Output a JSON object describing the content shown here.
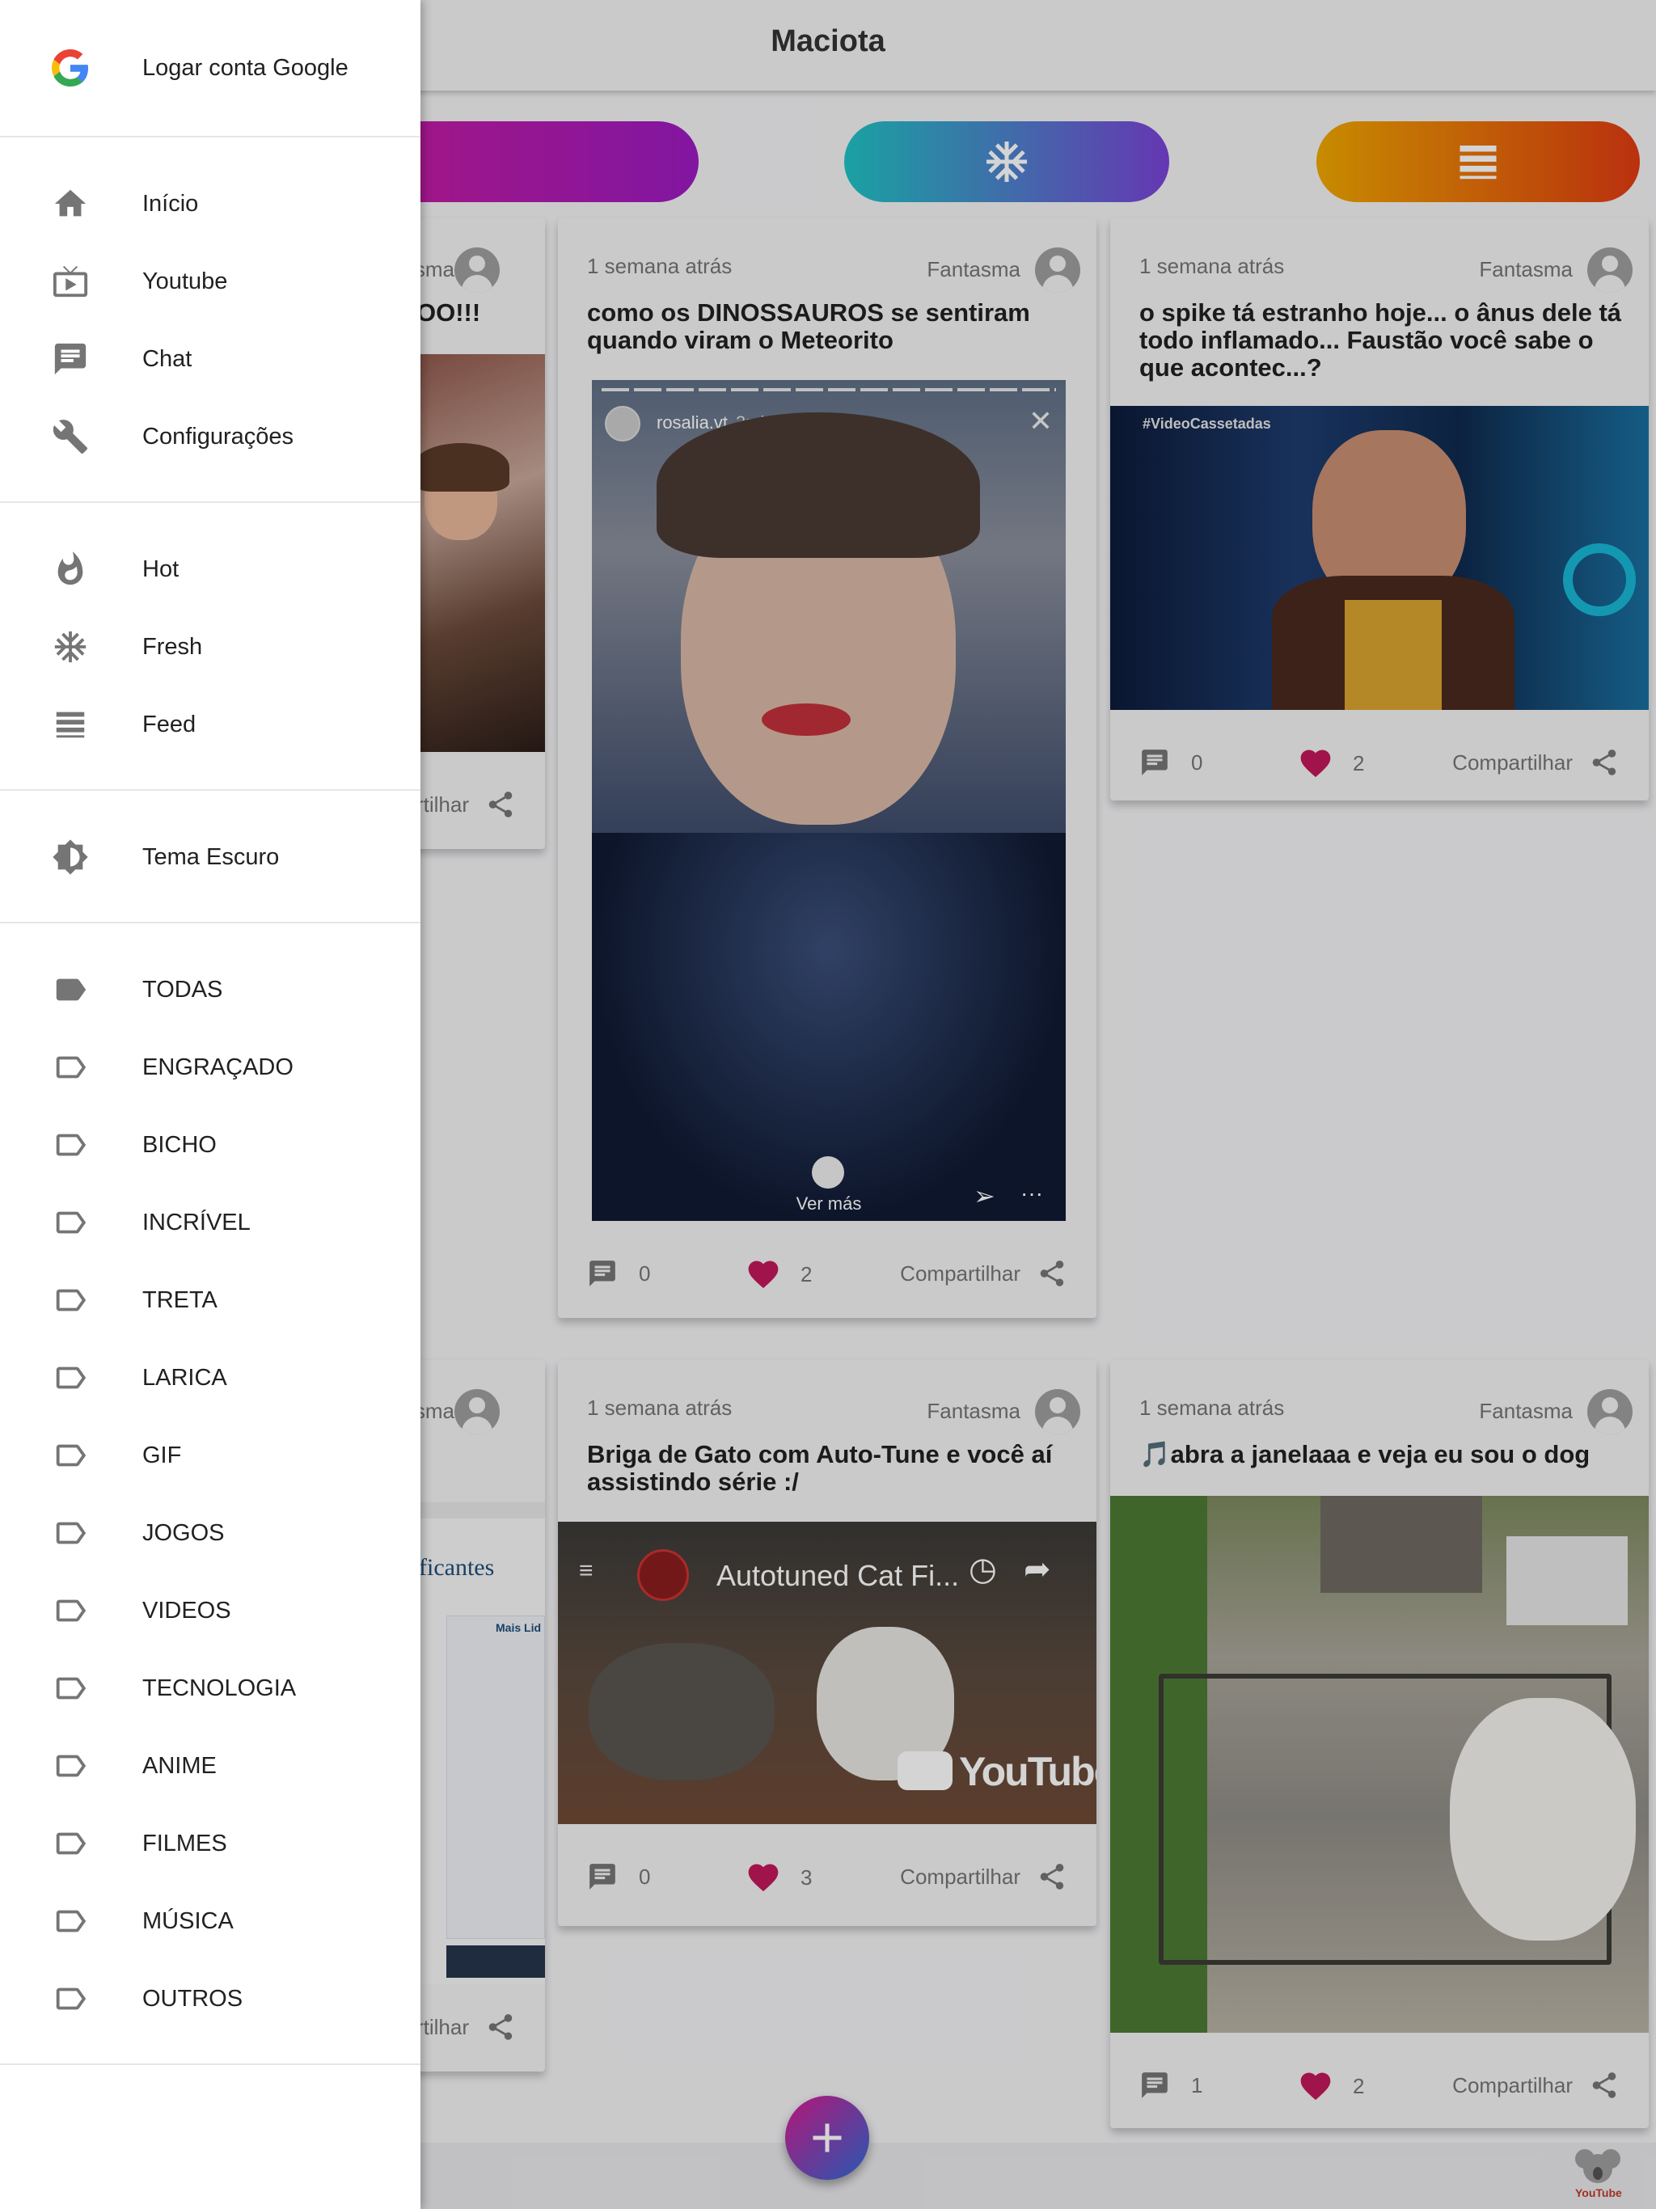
{
  "app": {
    "title": "Maciota"
  },
  "pills": [
    "hot-icon",
    "snowflake-icon",
    "feed-icon"
  ],
  "drawer": {
    "account": {
      "label": "Logar conta Google",
      "icon": "google-icon"
    },
    "nav": [
      {
        "label": "Início",
        "icon": "home-icon"
      },
      {
        "label": "Youtube",
        "icon": "tv-icon"
      },
      {
        "label": "Chat",
        "icon": "chat-icon"
      },
      {
        "label": "Configurações",
        "icon": "wrench-icon"
      }
    ],
    "feeds": [
      {
        "label": "Hot",
        "icon": "flame-icon"
      },
      {
        "label": "Fresh",
        "icon": "snowflake-icon"
      },
      {
        "label": "Feed",
        "icon": "feed-icon"
      }
    ],
    "theme": {
      "label": "Tema Escuro",
      "icon": "brightness-icon"
    },
    "categories": [
      {
        "label": "TODAS",
        "icon": "label-filled-icon"
      },
      {
        "label": "ENGRAÇADO",
        "icon": "label-outline-icon"
      },
      {
        "label": "BICHO",
        "icon": "label-outline-icon"
      },
      {
        "label": "INCRÍVEL",
        "icon": "label-outline-icon"
      },
      {
        "label": "TRETA",
        "icon": "label-outline-icon"
      },
      {
        "label": "LARICA",
        "icon": "label-outline-icon"
      },
      {
        "label": "GIF",
        "icon": "label-outline-icon"
      },
      {
        "label": "JOGOS",
        "icon": "label-outline-icon"
      },
      {
        "label": "VIDEOS",
        "icon": "label-outline-icon"
      },
      {
        "label": "TECNOLOGIA",
        "icon": "label-outline-icon"
      },
      {
        "label": "ANIME",
        "icon": "label-outline-icon"
      },
      {
        "label": "FILMES",
        "icon": "label-outline-icon"
      },
      {
        "label": "MÚSICA",
        "icon": "label-outline-icon"
      },
      {
        "label": "OUTROS",
        "icon": "label-outline-icon"
      }
    ]
  },
  "posts": [
    {
      "time": "",
      "user": "sma",
      "title": "OO!!!",
      "comments": "",
      "likes": "",
      "share": "rtilhar"
    },
    {
      "time": "1 semana atrás",
      "user": "Fantasma",
      "title": "como os DINOSSAUROS se sentiram quando viram o Meteorito",
      "media_caption": "rosalia.vt",
      "media_time": "3min",
      "media_more": "Ver más",
      "comments": "0",
      "likes": "2",
      "share": "Compartilhar"
    },
    {
      "time": "1 semana atrás",
      "user": "Fantasma",
      "title": "o spike tá estranho hoje... o ânus dele tá todo inflamado... Faustão você sabe o que acontec...?",
      "media_tag": "#VideoCassetadas",
      "comments": "0",
      "likes": "2",
      "share": "Compartilhar"
    },
    {
      "time": "",
      "user": "sma",
      "title": "",
      "media_heading": "ficantes",
      "media_side": "Mais Lid",
      "comments": "",
      "likes": "",
      "share": "rtilhar"
    },
    {
      "time": "1 semana atrás",
      "user": "Fantasma",
      "title": "Briga de Gato com Auto-Tune e você aí assistindo série :/",
      "video_title": "Autotuned Cat Fi...",
      "video_brand": "YouTube",
      "comments": "0",
      "likes": "3",
      "share": "Compartilhar"
    },
    {
      "time": "1 semana atrás",
      "user": "Fantasma",
      "title": "🎵abra a janelaaa e veja eu sou o dog",
      "comments": "1",
      "likes": "2",
      "share": "Compartilhar"
    }
  ],
  "footer": {
    "brand": "YouTube"
  },
  "colors": {
    "heart": "#c2185b",
    "hot_start": "#d81b92",
    "fresh_start": "#1fc3c4",
    "feed_start": "#f0a800"
  }
}
